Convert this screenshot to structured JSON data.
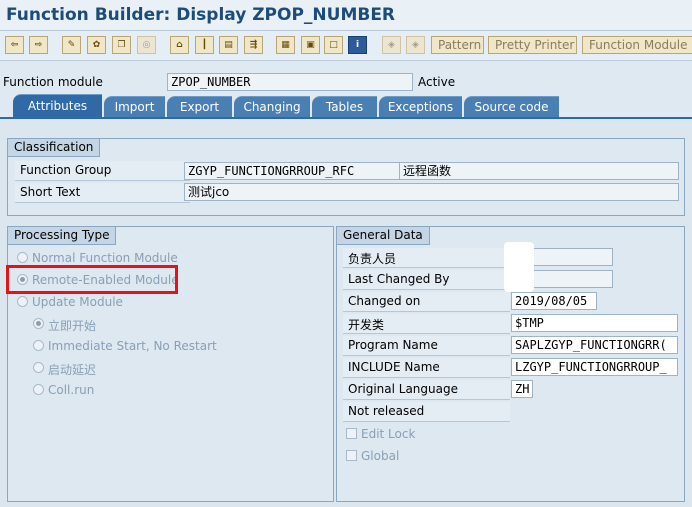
{
  "window": {
    "title": "Function Builder: Display ZPOP_NUMBER"
  },
  "toolbar": {
    "icons": [
      "back-arrow-icon",
      "forward-arrow-icon",
      "display-change-icon",
      "activate-icon",
      "copy-icon",
      "where-used-icon",
      "other-object-icon",
      "breakpoint-icon",
      "check-icon",
      "test-icon",
      "hierarchy-icon",
      "print-icon",
      "frame-icon",
      "info-icon",
      "pattern-icon",
      "pretty-printer-icon"
    ],
    "pattern_label": "Pattern",
    "pretty_printer_label": "Pretty Printer",
    "function_module_doc_label": "Function Module De"
  },
  "header": {
    "function_module_label": "Function module",
    "function_module_value": "ZPOP_NUMBER",
    "status": "Active"
  },
  "tabs": [
    "Attributes",
    "Import",
    "Export",
    "Changing",
    "Tables",
    "Exceptions",
    "Source code"
  ],
  "classification": {
    "title": "Classification",
    "function_group_label": "Function Group",
    "function_group_value": "ZGYP_FUNCTIONGRROUP_RFC",
    "function_group_desc": "远程函数",
    "short_text_label": "Short Text",
    "short_text_value": "测试jco"
  },
  "processing": {
    "title": "Processing Type",
    "normal": "Normal Function Module",
    "remote": "Remote-Enabled Module",
    "update": "Update Module",
    "immediate": "立即开始",
    "immediate_no_restart": "Immediate Start, No Restart",
    "delayed": "启动延迟",
    "coll_run": "Coll.run"
  },
  "general": {
    "title": "General Data",
    "responsible_label": "负责人员",
    "last_changed_label": "Last Changed By",
    "changed_on_label": "Changed on",
    "changed_on_value": "2019/08/05",
    "dev_class_label": "开发类",
    "dev_class_value": "$TMP",
    "program_label": "Program Name",
    "program_value": "SAPLZGYP_FUNCTIONGRR(",
    "include_label": "INCLUDE Name",
    "include_value": "LZGYP_FUNCTIONGRROUP_",
    "orig_lang_label": "Original Language",
    "orig_lang_value": "ZH",
    "not_released": "Not released",
    "edit_lock": "Edit Lock",
    "global": "Global"
  },
  "colors": {
    "title": "#1c4b7c",
    "tab": "#4a7fb4",
    "highlight": "#e0141f"
  }
}
